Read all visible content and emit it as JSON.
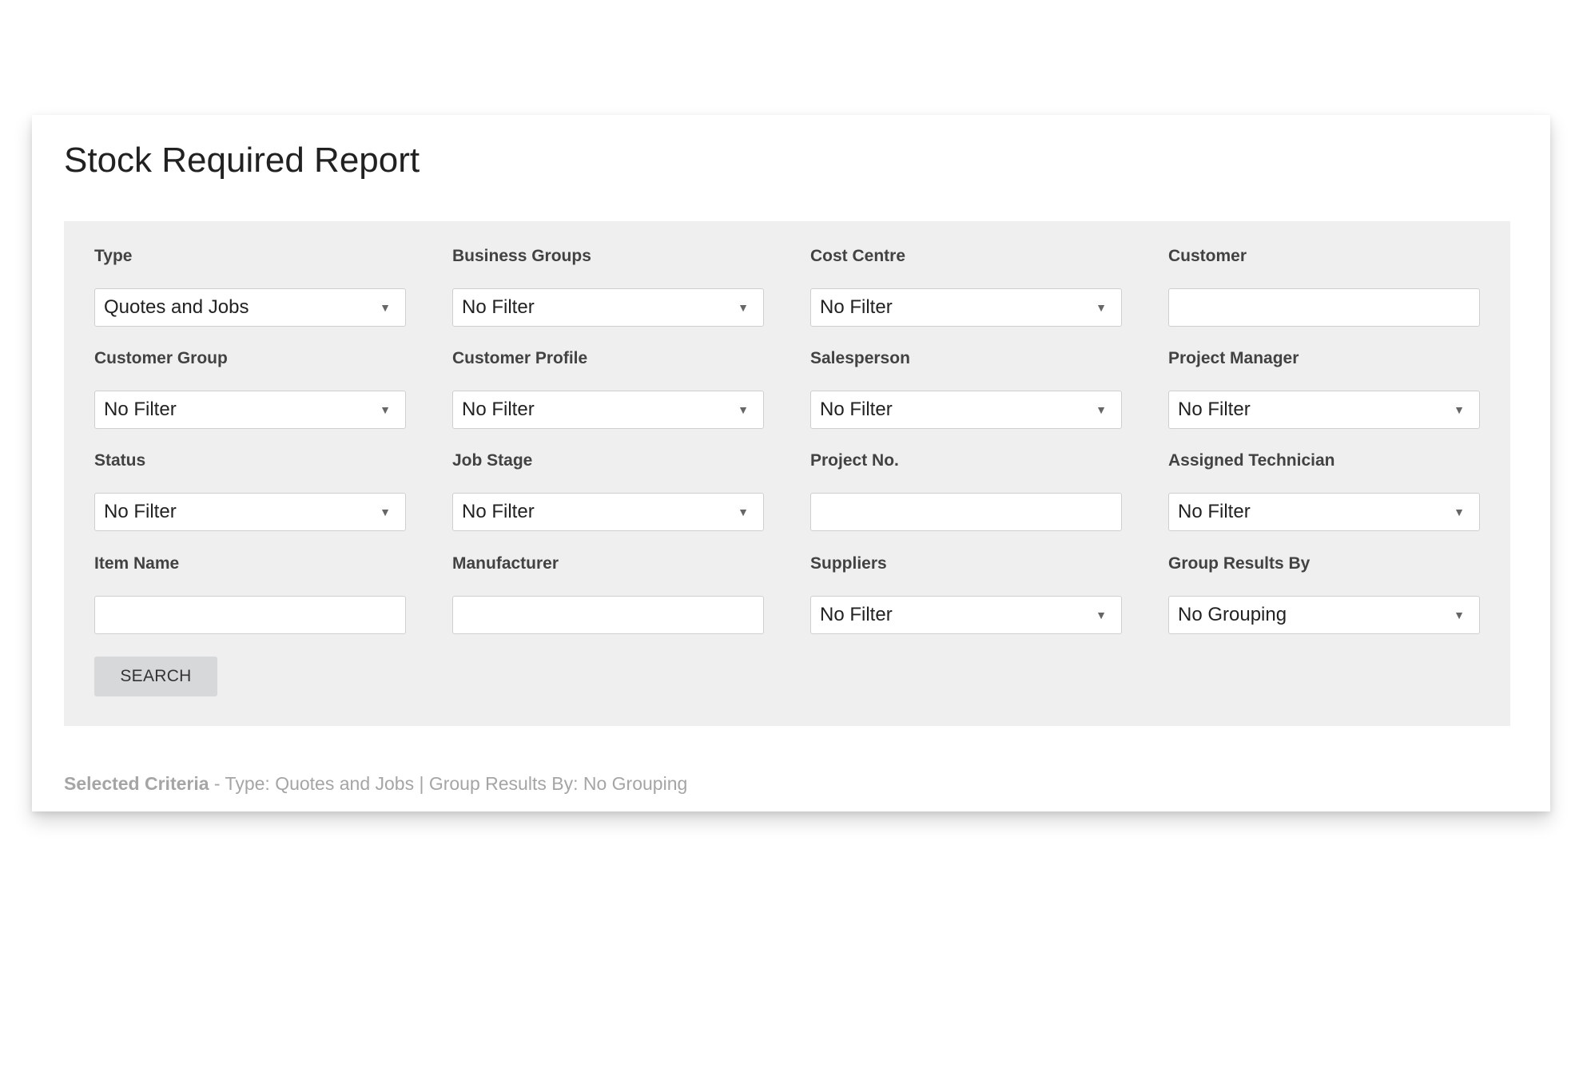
{
  "page": {
    "title": "Stock Required Report"
  },
  "filters": [
    {
      "id": "type",
      "label": "Type",
      "kind": "select",
      "value": "Quotes and Jobs"
    },
    {
      "id": "business-groups",
      "label": "Business Groups",
      "kind": "select",
      "value": "No Filter"
    },
    {
      "id": "cost-centre",
      "label": "Cost Centre",
      "kind": "select",
      "value": "No Filter"
    },
    {
      "id": "customer",
      "label": "Customer",
      "kind": "text",
      "value": ""
    },
    {
      "id": "customer-group",
      "label": "Customer Group",
      "kind": "select",
      "value": "No Filter"
    },
    {
      "id": "customer-profile",
      "label": "Customer Profile",
      "kind": "select",
      "value": "No Filter"
    },
    {
      "id": "salesperson",
      "label": "Salesperson",
      "kind": "select",
      "value": "No Filter"
    },
    {
      "id": "project-manager",
      "label": "Project Manager",
      "kind": "select",
      "value": "No Filter"
    },
    {
      "id": "status",
      "label": "Status",
      "kind": "select",
      "value": "No Filter"
    },
    {
      "id": "job-stage",
      "label": "Job Stage",
      "kind": "select",
      "value": "No Filter"
    },
    {
      "id": "project-no",
      "label": "Project No.",
      "kind": "text",
      "value": ""
    },
    {
      "id": "assigned-technician",
      "label": "Assigned Technician",
      "kind": "select",
      "value": "No Filter"
    },
    {
      "id": "item-name",
      "label": "Item Name",
      "kind": "text",
      "value": ""
    },
    {
      "id": "manufacturer",
      "label": "Manufacturer",
      "kind": "text",
      "value": ""
    },
    {
      "id": "suppliers",
      "label": "Suppliers",
      "kind": "select",
      "value": "No Filter"
    },
    {
      "id": "group-results-by",
      "label": "Group Results By",
      "kind": "select",
      "value": "No Grouping"
    }
  ],
  "search_button": {
    "label": "SEARCH"
  },
  "selected_criteria": {
    "label": "Selected Criteria",
    "text": " - Type: Quotes and Jobs | Group Results By: No Grouping"
  },
  "icons": {
    "select_arrow": "caret-down-icon"
  },
  "colors": {
    "panel_background": "#efefef",
    "button_background": "#d6d8da",
    "criteria_text": "#a5a5a5"
  }
}
